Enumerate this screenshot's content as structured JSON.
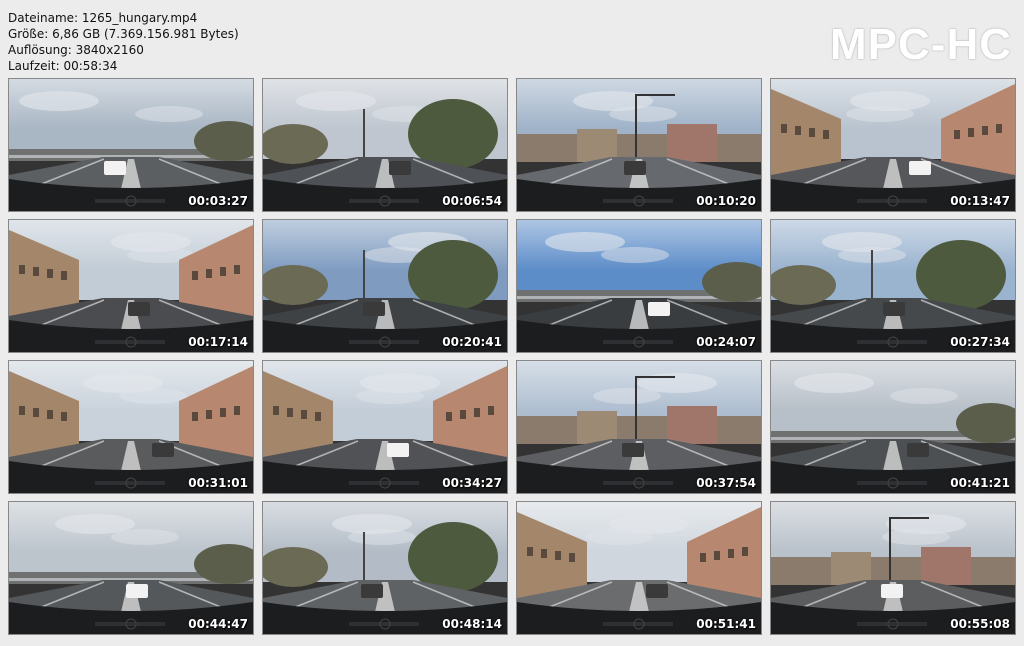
{
  "file_info": {
    "filename": "Dateiname: 1265_hungary.mp4",
    "size": "Größe: 6,86 GB (7.369.156.981 Bytes)",
    "resolution": "Auflösung: 3840x2160",
    "duration": "Laufzeit: 00:58:34"
  },
  "logo": "MPC-HC",
  "thumbnails": [
    {
      "time": "00:03:27",
      "sky": "#a9b6c4",
      "ground": "#5b5f62",
      "scene": "highway"
    },
    {
      "time": "00:06:54",
      "sky": "#bfc6cf",
      "ground": "#4e5155",
      "scene": "street"
    },
    {
      "time": "00:10:20",
      "sky": "#9fb2c8",
      "ground": "#66696d",
      "scene": "intersection"
    },
    {
      "time": "00:13:47",
      "sky": "#b8c3cf",
      "ground": "#55575a",
      "scene": "buildings"
    },
    {
      "time": "00:17:14",
      "sky": "#c2ccd6",
      "ground": "#4a4c4f",
      "scene": "buildings"
    },
    {
      "time": "00:20:41",
      "sky": "#7f9cc0",
      "ground": "#3f4245",
      "scene": "street"
    },
    {
      "time": "00:24:07",
      "sky": "#5d8dc9",
      "ground": "#3a3d40",
      "scene": "highway"
    },
    {
      "time": "00:27:34",
      "sky": "#9ab3cf",
      "ground": "#46494c",
      "scene": "street"
    },
    {
      "time": "00:31:01",
      "sky": "#c9d2db",
      "ground": "#5a5b5d",
      "scene": "buildings"
    },
    {
      "time": "00:34:27",
      "sky": "#c3cdd8",
      "ground": "#505255",
      "scene": "buildings"
    },
    {
      "time": "00:37:54",
      "sky": "#aebed0",
      "ground": "#5c5e61",
      "scene": "intersection"
    },
    {
      "time": "00:41:21",
      "sky": "#b7bfc8",
      "ground": "#4d5053",
      "scene": "highway"
    },
    {
      "time": "00:44:47",
      "sky": "#bcc4cc",
      "ground": "#55585b",
      "scene": "highway"
    },
    {
      "time": "00:48:14",
      "sky": "#b3bcc6",
      "ground": "#5f6265",
      "scene": "street"
    },
    {
      "time": "00:51:41",
      "sky": "#cfd6dd",
      "ground": "#6a6c6e",
      "scene": "buildings"
    },
    {
      "time": "00:55:08",
      "sky": "#b9c1ca",
      "ground": "#5b5d5f",
      "scene": "intersection"
    }
  ]
}
